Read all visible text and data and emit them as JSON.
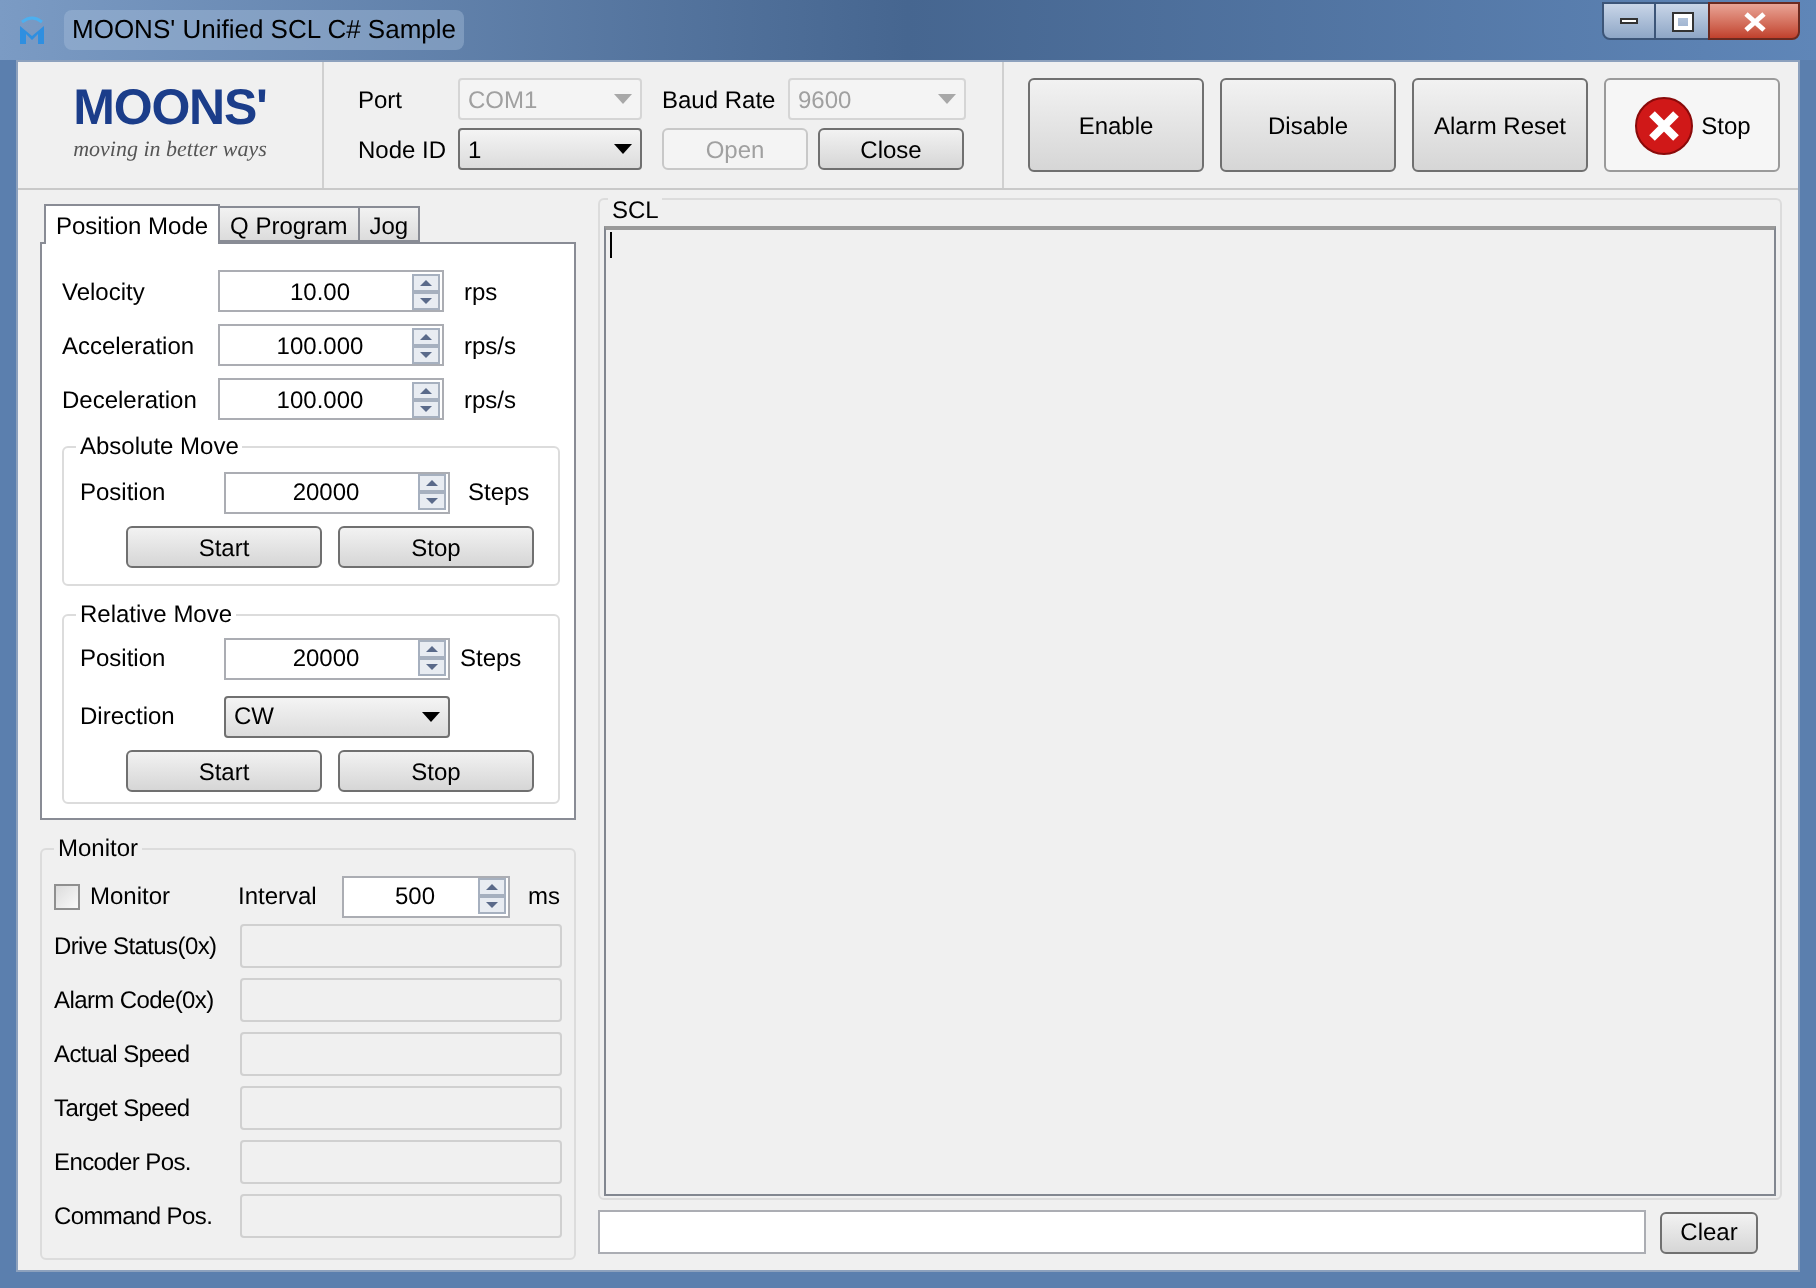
{
  "window": {
    "title": "MOONS' Unified SCL C# Sample"
  },
  "logo": {
    "brand": "MOONS'",
    "tagline": "moving in better ways"
  },
  "connection": {
    "port": {
      "label": "Port",
      "value": "COM1",
      "disabled": true
    },
    "baud_rate": {
      "label": "Baud Rate",
      "value": "9600",
      "disabled": true
    },
    "node_id": {
      "label": "Node ID",
      "value": "1",
      "disabled": false
    },
    "buttons": [
      {
        "label": "Open",
        "disabled": true
      },
      {
        "label": "Close",
        "disabled": false
      }
    ]
  },
  "actions": [
    {
      "label": "Enable",
      "kind": "plain"
    },
    {
      "label": "Disable",
      "kind": "plain"
    },
    {
      "label": "Alarm Reset",
      "kind": "plain"
    },
    {
      "label": "Stop",
      "kind": "stop"
    }
  ],
  "tabs": [
    {
      "label": "Position Mode",
      "selected": true
    },
    {
      "label": "Q Program",
      "selected": false
    },
    {
      "label": "Jog",
      "selected": false
    }
  ],
  "motion": [
    {
      "label": "Velocity",
      "value": "10.00",
      "unit": "rps"
    },
    {
      "label": "Acceleration",
      "value": "100.000",
      "unit": "rps/s"
    },
    {
      "label": "Deceleration",
      "value": "100.000",
      "unit": "rps/s"
    }
  ],
  "absolute_move": {
    "title": "Absolute Move",
    "position": {
      "label": "Position",
      "value": "20000",
      "unit": "Steps"
    },
    "buttons": [
      "Start",
      "Stop"
    ]
  },
  "relative_move": {
    "title": "Relative Move",
    "position": {
      "label": "Position",
      "value": "20000",
      "unit": "Steps"
    },
    "direction": {
      "label": "Direction",
      "value": "CW"
    },
    "buttons": [
      "Start",
      "Stop"
    ]
  },
  "monitor": {
    "title": "Monitor",
    "checkbox": {
      "label": "Monitor",
      "checked": false
    },
    "interval": {
      "label": "Interval",
      "value": "500",
      "unit": "ms"
    },
    "readouts": [
      {
        "label": "Drive Status(0x)"
      },
      {
        "label": "Alarm Code(0x)"
      },
      {
        "label": "Actual Speed"
      },
      {
        "label": "Target Speed"
      },
      {
        "label": "Encoder Pos."
      },
      {
        "label": "Command Pos."
      }
    ]
  },
  "scl": {
    "title": "SCL",
    "clear_button": "Clear"
  }
}
